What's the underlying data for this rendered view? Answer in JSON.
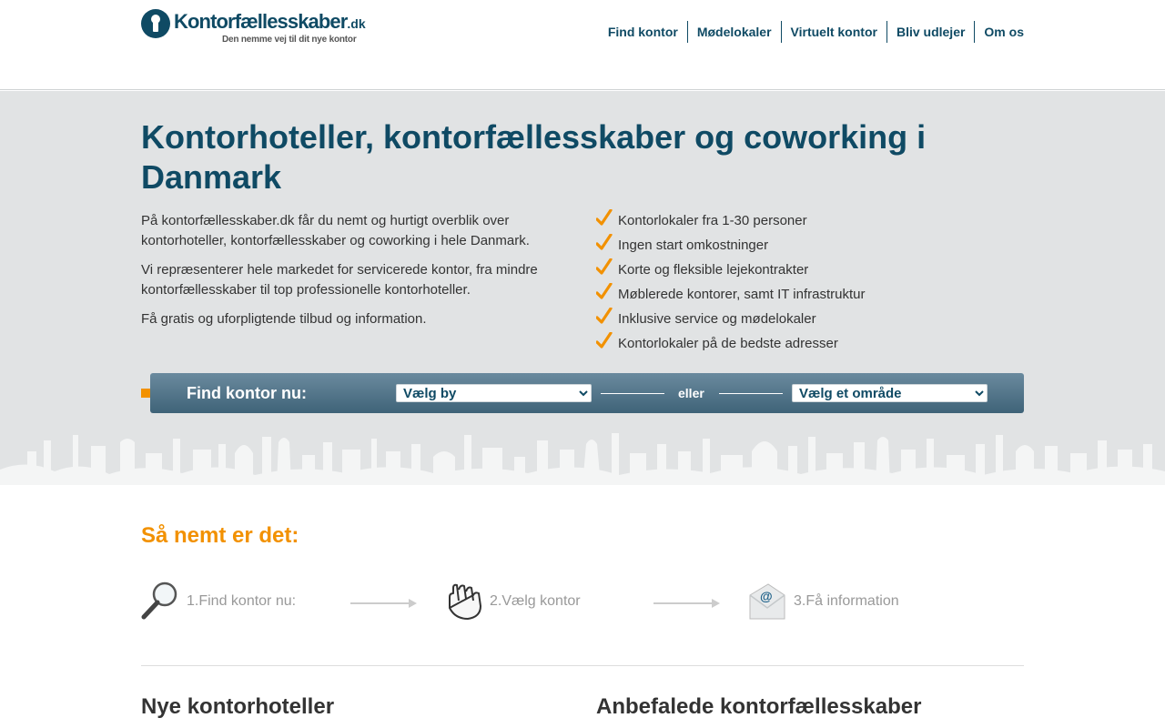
{
  "logo": {
    "name": "Kontorfællesskaber",
    "tld": ".dk",
    "tagline": "Den nemme vej til dit nye kontor"
  },
  "nav": {
    "items": [
      "Find kontor",
      "Mødelokaler",
      "Virtuelt kontor",
      "Bliv udlejer",
      "Om os"
    ]
  },
  "hero": {
    "title": "Kontorhoteller, kontorfællesskaber og coworking i Danmark",
    "intro": [
      "På kontorfællesskaber.dk får du nemt og hurtigt overblik over kontorhoteller, kontorfællesskaber og coworking i hele Danmark.",
      "Vi repræsenterer hele markedet for servicerede kontor, fra mindre kontorfællesskaber til top professionelle kontorhoteller.",
      "Få gratis og uforpligtende tilbud og information."
    ],
    "benefits": [
      "Kontorlokaler fra 1-30 personer",
      "Ingen start omkostninger",
      "Korte og fleksible lejekontrakter",
      "Møblerede kontorer, samt IT infrastruktur",
      "Inklusive service og mødelokaler",
      "Kontorlokaler på de bedste adresser"
    ]
  },
  "findbar": {
    "label": "Find kontor nu:",
    "city_select": "Vælg by",
    "or_label": "eller",
    "area_select": "Vælg et område"
  },
  "how": {
    "title": "Så nemt er det:",
    "steps": [
      "1.Find kontor nu:",
      "2.Vælg kontor",
      "3.Få information"
    ]
  },
  "sections": {
    "new_hotels": "Nye kontorhoteller",
    "recommended": "Anbefalede kontorfællesskaber"
  },
  "colors": {
    "brand": "#0f4a64",
    "accent": "#f29100",
    "hero_bg": "#e1e3e4"
  }
}
